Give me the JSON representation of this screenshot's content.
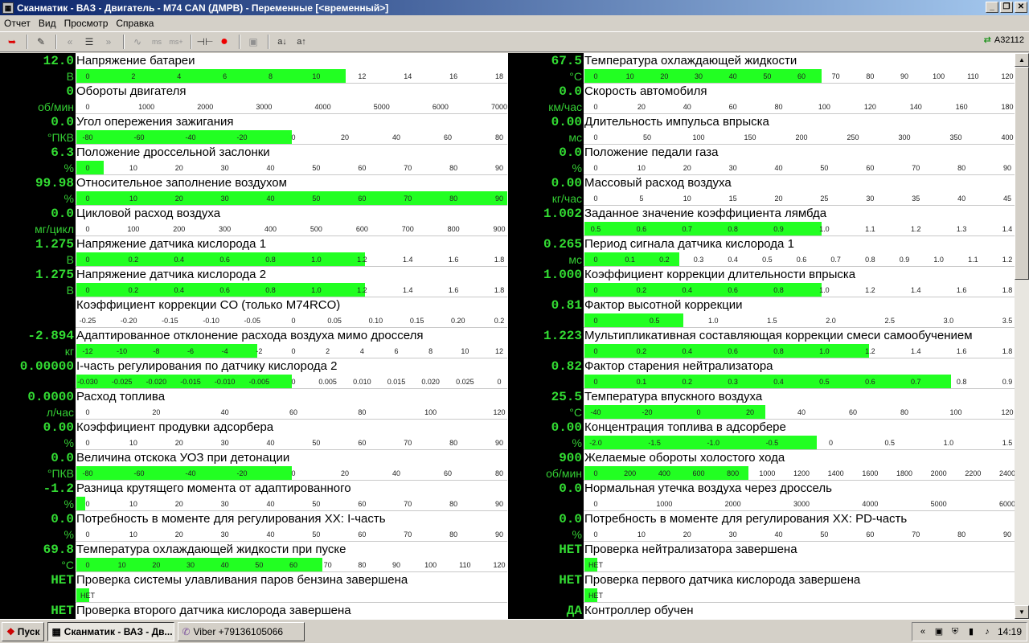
{
  "window": {
    "title": "Сканматик - ВАЗ - Двигатель - M74 CAN (ДМРВ) - Переменные [<временный>]"
  },
  "menu": [
    "Отчет",
    "Вид",
    "Просмотр",
    "Справка"
  ],
  "toolbar": {
    "device_label": "A32112"
  },
  "colors": {
    "value_bg": "#000000",
    "value_fg": "#33dd33",
    "bar": "#22ff22"
  },
  "params_left": [
    {
      "name": "Напряжение батареи",
      "value": "12.0",
      "unit": "В",
      "ticks": [
        "0",
        "2",
        "4",
        "6",
        "8",
        "10",
        "12",
        "14",
        "16",
        "18"
      ],
      "fill": 0.625
    },
    {
      "name": "Обороты  двигателя",
      "value": "0",
      "unit": "об/мин",
      "ticks": [
        "0",
        "1000",
        "2000",
        "3000",
        "4000",
        "5000",
        "6000",
        "7000"
      ],
      "fill": 0
    },
    {
      "name": "Угол опережения зажигания",
      "value": "0.0",
      "unit": "°ПКВ",
      "ticks": [
        "-80",
        "-60",
        "-40",
        "-20",
        "0",
        "20",
        "40",
        "60",
        "80"
      ],
      "fill": 0.5
    },
    {
      "name": "Положение дроссельной заслонки",
      "value": "6.3",
      "unit": "%",
      "ticks": [
        "0",
        "10",
        "20",
        "30",
        "40",
        "50",
        "60",
        "70",
        "80",
        "90"
      ],
      "fill": 0.063
    },
    {
      "name": "Относительное заполнение воздухом",
      "value": "99.98",
      "unit": "%",
      "ticks": [
        "0",
        "10",
        "20",
        "30",
        "40",
        "50",
        "60",
        "70",
        "80",
        "90"
      ],
      "fill": 1
    },
    {
      "name": "Цикловой расход воздуха",
      "value": "0.0",
      "unit": "мг/цикл",
      "ticks": [
        "0",
        "100",
        "200",
        "300",
        "400",
        "500",
        "600",
        "700",
        "800",
        "900"
      ],
      "fill": 0
    },
    {
      "name": "Напряжение датчика кислорода 1",
      "value": "1.275",
      "unit": "В",
      "ticks": [
        "0",
        "0.2",
        "0.4",
        "0.6",
        "0.8",
        "1.0",
        "1.2",
        "1.4",
        "1.6",
        "1.8"
      ],
      "fill": 0.67
    },
    {
      "name": "Напряжение датчика кислорода 2",
      "value": "1.275",
      "unit": "В",
      "ticks": [
        "0",
        "0.2",
        "0.4",
        "0.6",
        "0.8",
        "1.0",
        "1.2",
        "1.4",
        "1.6",
        "1.8"
      ],
      "fill": 0.67
    },
    {
      "name": "Коэффициент коррекции CO (только M74RCO)",
      "value": "",
      "unit": "",
      "ticks": [
        "-0.25",
        "-0.20",
        "-0.15",
        "-0.10",
        "-0.05",
        "0",
        "0.05",
        "0.10",
        "0.15",
        "0.20",
        "0.2"
      ],
      "fill": 0
    },
    {
      "name": "Адаптированное отклонение расхода воздуха мимо дросселя",
      "value": "-2.894",
      "unit": "кг",
      "ticks": [
        "-12",
        "-10",
        "-8",
        "-6",
        "-4",
        "-2",
        "0",
        "2",
        "4",
        "6",
        "8",
        "10",
        "12"
      ],
      "fill": 0.42
    },
    {
      "name": "I-часть регулирования по датчику кислорода 2",
      "value": "0.00000",
      "unit": "",
      "ticks": [
        "-0.030",
        "-0.025",
        "-0.020",
        "-0.015",
        "-0.010",
        "-0.005",
        "0",
        "0.005",
        "0.010",
        "0.015",
        "0.020",
        "0.025",
        "0"
      ],
      "fill": 0.5
    },
    {
      "name": "Расход топлива",
      "value": "0.0000",
      "unit": "л/час",
      "ticks": [
        "0",
        "20",
        "40",
        "60",
        "80",
        "100",
        "120"
      ],
      "fill": 0
    },
    {
      "name": "Коэффициент продувки адсорбера",
      "value": "0.00",
      "unit": "%",
      "ticks": [
        "0",
        "10",
        "20",
        "30",
        "40",
        "50",
        "60",
        "70",
        "80",
        "90"
      ],
      "fill": 0
    },
    {
      "name": "Величина отскока УОЗ при детонации",
      "value": "0.0",
      "unit": "°ПКВ",
      "ticks": [
        "-80",
        "-60",
        "-40",
        "-20",
        "0",
        "20",
        "40",
        "60",
        "80"
      ],
      "fill": 0.5
    },
    {
      "name": "Разница крутящего момента от адаптированного",
      "value": "-1.2",
      "unit": "%",
      "ticks": [
        "0",
        "10",
        "20",
        "30",
        "40",
        "50",
        "60",
        "70",
        "80",
        "90"
      ],
      "fill": 0.02
    },
    {
      "name": "Потребность в моменте для регулирования XX: I-часть",
      "value": "0.0",
      "unit": "%",
      "ticks": [
        "0",
        "10",
        "20",
        "30",
        "40",
        "50",
        "60",
        "70",
        "80",
        "90"
      ],
      "fill": 0
    },
    {
      "name": "Температура охлаждающей жидкости при пуске",
      "value": "69.8",
      "unit": "°C",
      "ticks": [
        "0",
        "10",
        "20",
        "30",
        "40",
        "50",
        "60",
        "70",
        "80",
        "90",
        "100",
        "110",
        "120"
      ],
      "fill": 0.57
    },
    {
      "name": "Проверка системы улавливания паров бензина завершена",
      "value": "НЕТ",
      "unit": "",
      "ticks": [
        "НЕТ"
      ],
      "fill": 0.03
    },
    {
      "name": "Проверка второго датчика кислорода завершена",
      "value": "НЕТ",
      "unit": "",
      "ticks": [],
      "fill": 0
    }
  ],
  "params_right": [
    {
      "name": "Температура охлаждающей жидкости",
      "value": "67.5",
      "unit": "°C",
      "ticks": [
        "0",
        "10",
        "20",
        "30",
        "40",
        "50",
        "60",
        "70",
        "80",
        "90",
        "100",
        "110",
        "120"
      ],
      "fill": 0.55
    },
    {
      "name": "Скорость автомобиля",
      "value": "0.0",
      "unit": "км/час",
      "ticks": [
        "0",
        "20",
        "40",
        "60",
        "80",
        "100",
        "120",
        "140",
        "160",
        "180"
      ],
      "fill": 0
    },
    {
      "name": "Длительность импульса впрыска",
      "value": "0.00",
      "unit": "мс",
      "ticks": [
        "0",
        "50",
        "100",
        "150",
        "200",
        "250",
        "300",
        "350",
        "400"
      ],
      "fill": 0
    },
    {
      "name": "Положение педали газа",
      "value": "0.0",
      "unit": "%",
      "ticks": [
        "0",
        "10",
        "20",
        "30",
        "40",
        "50",
        "60",
        "70",
        "80",
        "90"
      ],
      "fill": 0
    },
    {
      "name": "Массовый расход воздуха",
      "value": "0.00",
      "unit": "кг/час",
      "ticks": [
        "0",
        "5",
        "10",
        "15",
        "20",
        "25",
        "30",
        "35",
        "40",
        "45"
      ],
      "fill": 0
    },
    {
      "name": "Заданное значение коэффициента лямбда",
      "value": "1.002",
      "unit": "",
      "ticks": [
        "0.5",
        "0.6",
        "0.7",
        "0.8",
        "0.9",
        "1.0",
        "1.1",
        "1.2",
        "1.3",
        "1.4"
      ],
      "fill": 0.55
    },
    {
      "name": "Период сигнала датчика кислорода 1",
      "value": "0.265",
      "unit": "мс",
      "ticks": [
        "0",
        "0.1",
        "0.2",
        "0.3",
        "0.4",
        "0.5",
        "0.6",
        "0.7",
        "0.8",
        "0.9",
        "1.0",
        "1.1",
        "1.2"
      ],
      "fill": 0.22
    },
    {
      "name": "Коэффициент коррекции длительности впрыска",
      "value": "1.000",
      "unit": "",
      "ticks": [
        "0",
        "0.2",
        "0.4",
        "0.6",
        "0.8",
        "1.0",
        "1.2",
        "1.4",
        "1.6",
        "1.8"
      ],
      "fill": 0.55
    },
    {
      "name": "Фактор высотной коррекции",
      "value": "0.81",
      "unit": "",
      "ticks": [
        "0",
        "0.5",
        "1.0",
        "1.5",
        "2.0",
        "2.5",
        "3.0",
        "3.5"
      ],
      "fill": 0.23
    },
    {
      "name": "Мультипликативная составляющая коррекции смеси самообучением",
      "value": "1.223",
      "unit": "",
      "ticks": [
        "0",
        "0.2",
        "0.4",
        "0.6",
        "0.8",
        "1.0",
        "1.2",
        "1.4",
        "1.6",
        "1.8"
      ],
      "fill": 0.66
    },
    {
      "name": "Фактор старения нейтрализатора",
      "value": "0.82",
      "unit": "",
      "ticks": [
        "0",
        "0.1",
        "0.2",
        "0.3",
        "0.4",
        "0.5",
        "0.6",
        "0.7",
        "0.8",
        "0.9"
      ],
      "fill": 0.85
    },
    {
      "name": "Температура впускного воздуха",
      "value": "25.5",
      "unit": "°C",
      "ticks": [
        "-40",
        "-20",
        "0",
        "20",
        "40",
        "60",
        "80",
        "100",
        "120"
      ],
      "fill": 0.42
    },
    {
      "name": "Концентрация топлива в адсорбере",
      "value": "0.00",
      "unit": "%",
      "ticks": [
        "-2.0",
        "-1.5",
        "-1.0",
        "-0.5",
        "0",
        "0.5",
        "1.0",
        "1.5"
      ],
      "fill": 0.54
    },
    {
      "name": "Желаемые обороты холостого хода",
      "value": "900",
      "unit": "об/мин",
      "ticks": [
        "0",
        "200",
        "400",
        "600",
        "800",
        "1000",
        "1200",
        "1400",
        "1600",
        "1800",
        "2000",
        "2200",
        "2400"
      ],
      "fill": 0.38
    },
    {
      "name": "Нормальная утечка воздуха через дроссель",
      "value": "0.0",
      "unit": "",
      "ticks": [
        "0",
        "1000",
        "2000",
        "3000",
        "4000",
        "5000",
        "6000"
      ],
      "fill": 0
    },
    {
      "name": "Потребность в моменте для регулирования XX: PD-часть",
      "value": "0.0",
      "unit": "%",
      "ticks": [
        "0",
        "10",
        "20",
        "30",
        "40",
        "50",
        "60",
        "70",
        "80",
        "90"
      ],
      "fill": 0
    },
    {
      "name": "Проверка нейтрализатора завершена",
      "value": "НЕТ",
      "unit": "",
      "ticks": [
        "НЕТ"
      ],
      "fill": 0.03
    },
    {
      "name": "Проверка первого датчика кислорода завершена",
      "value": "НЕТ",
      "unit": "",
      "ticks": [
        "НЕТ"
      ],
      "fill": 0.03
    },
    {
      "name": "Контроллер обучен",
      "value": "ДА",
      "unit": "",
      "ticks": [],
      "fill": 0
    }
  ],
  "taskbar": {
    "start_label": "Пуск",
    "tasks": [
      "Сканматик - ВАЗ - Дв...",
      "Viber +79136105066"
    ],
    "clock": "14:19"
  }
}
